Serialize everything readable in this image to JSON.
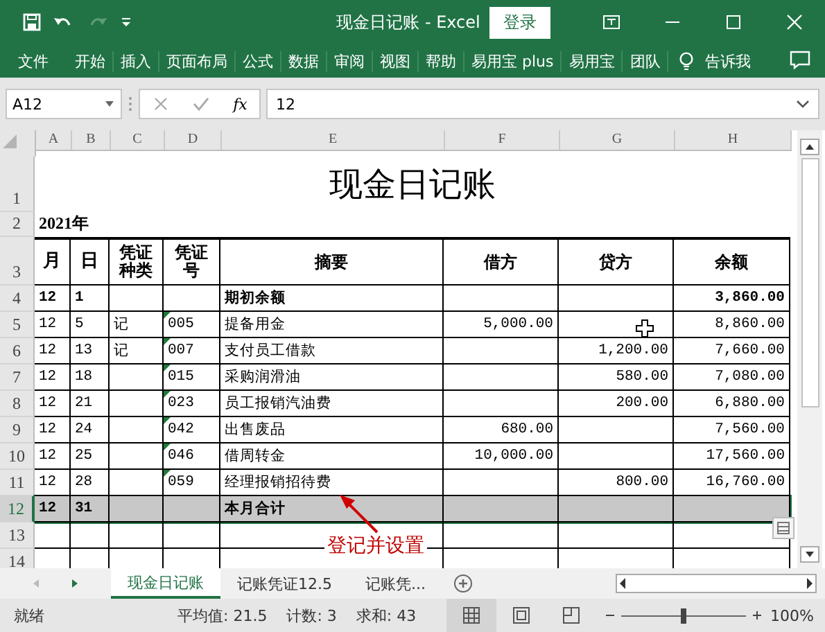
{
  "window": {
    "title": "现金日记账  -  Excel",
    "login_button": "登录"
  },
  "ribbon_tabs": [
    "文件",
    "开始",
    "插入",
    "页面布局",
    "公式",
    "数据",
    "审阅",
    "视图",
    "帮助",
    "易用宝 plus",
    "易用宝",
    "团队"
  ],
  "tell_me": "告诉我",
  "formula_bar": {
    "name_box": "A12",
    "fx": "fx",
    "value": "12"
  },
  "column_headers": [
    "A",
    "B",
    "C",
    "D",
    "E",
    "F",
    "G",
    "H"
  ],
  "sheet": {
    "title_row": {
      "number": "1",
      "text": "现金日记账"
    },
    "year_row": {
      "number": "2",
      "text": "2021年"
    },
    "header_row": {
      "number": "3",
      "cells": [
        "月",
        "日",
        "凭证种类",
        "凭证号",
        "摘要",
        "借方",
        "贷方",
        "余额"
      ]
    },
    "rows": [
      {
        "number": "4",
        "bold": true,
        "selected": false,
        "shaded": false,
        "flagged": false,
        "month": "12",
        "day": "1",
        "summary": "期初余额",
        "balance": "3,860.00"
      },
      {
        "number": "5",
        "bold": false,
        "selected": false,
        "shaded": false,
        "flagged": true,
        "month": "12",
        "day": "5",
        "voucher_type": "记",
        "voucher_no": "005",
        "summary": "提备用金",
        "debit": "5,000.00",
        "balance": "8,860.00"
      },
      {
        "number": "6",
        "bold": false,
        "selected": false,
        "shaded": false,
        "flagged": true,
        "month": "12",
        "day": "13",
        "voucher_type": "记",
        "voucher_no": "007",
        "summary": "支付员工借款",
        "credit": "1,200.00",
        "balance": "7,660.00"
      },
      {
        "number": "7",
        "bold": false,
        "selected": false,
        "shaded": false,
        "flagged": true,
        "month": "12",
        "day": "18",
        "voucher_no": "015",
        "summary": "采购润滑油",
        "credit": "580.00",
        "balance": "7,080.00"
      },
      {
        "number": "8",
        "bold": false,
        "selected": false,
        "shaded": false,
        "flagged": true,
        "month": "12",
        "day": "21",
        "voucher_no": "023",
        "summary": "员工报销汽油费",
        "credit": "200.00",
        "balance": "6,880.00"
      },
      {
        "number": "9",
        "bold": false,
        "selected": false,
        "shaded": false,
        "flagged": true,
        "month": "12",
        "day": "24",
        "voucher_no": "042",
        "summary": "出售废品",
        "debit": "680.00",
        "balance": "7,560.00"
      },
      {
        "number": "10",
        "bold": false,
        "selected": false,
        "shaded": false,
        "flagged": true,
        "month": "12",
        "day": "25",
        "voucher_no": "046",
        "summary": "借周转金",
        "debit": "10,000.00",
        "balance": "17,560.00"
      },
      {
        "number": "11",
        "bold": false,
        "selected": false,
        "shaded": false,
        "flagged": true,
        "month": "12",
        "day": "28",
        "voucher_no": "059",
        "summary": "经理报销招待费",
        "credit": "800.00",
        "balance": "16,760.00"
      },
      {
        "number": "12",
        "bold": true,
        "selected": true,
        "shaded": true,
        "flagged": false,
        "month": "12",
        "day": "31",
        "summary": "本月合计"
      },
      {
        "number": "13",
        "selected": false
      },
      {
        "number": "14",
        "selected": false
      }
    ]
  },
  "annotation": {
    "text": "登记并设置"
  },
  "sheet_tabs": [
    {
      "label": "现金日记账",
      "selected": true
    },
    {
      "label": "记账凭证12.5",
      "selected": false
    },
    {
      "label": "记账凭...",
      "selected": false
    }
  ],
  "status_bar": {
    "state": "就绪",
    "average": "平均值: 21.5",
    "count": "计数: 3",
    "sum": "求和: 43",
    "views": [
      {
        "kind": "normal",
        "selected": true
      },
      {
        "kind": "layout",
        "selected": false
      },
      {
        "kind": "pagebreak",
        "selected": false
      }
    ],
    "zoom": {
      "level": 0.5,
      "reading": "100%"
    }
  }
}
